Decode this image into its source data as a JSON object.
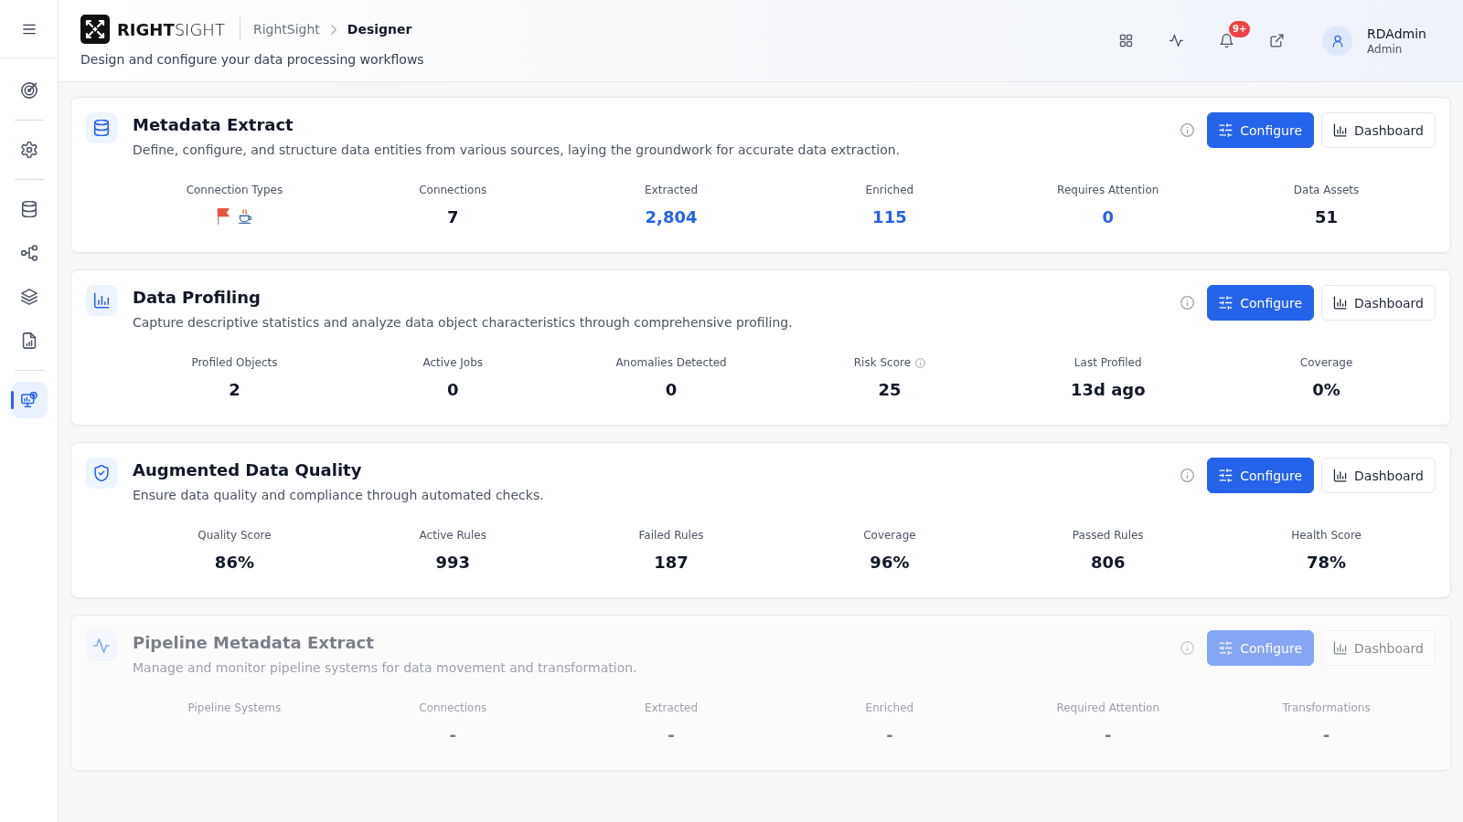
{
  "sidebar": {
    "groups": [
      [
        {
          "selected": false
        }
      ],
      [
        {
          "selected": false
        }
      ],
      [
        {
          "selected": false
        },
        {
          "selected": false
        },
        {
          "selected": false
        },
        {
          "selected": false
        }
      ],
      [
        {
          "selected": true
        }
      ]
    ]
  },
  "header": {
    "brand": "**RIGHT**SIGHT",
    "breadcrumb": [
      {
        "label": "RightSight",
        "current": false
      },
      {
        "label": "Designer",
        "current": true
      }
    ],
    "subtitle": "Design and configure your data processing workflows",
    "notification_badge": "9+",
    "user": {
      "name": "RDAdmin",
      "role": "Admin"
    }
  },
  "cards": [
    {
      "title": "Metadata Extract",
      "description": "Define, configure, and structure data entities from various sources, laying the groundwork for accurate data extraction.",
      "disabled": false,
      "buttons": [
        {
          "label": "Configure",
          "kind": "primary"
        },
        {
          "label": "Dashboard",
          "kind": "outline"
        }
      ],
      "stats": [
        {
          "label": "Connection Types",
          "kind": "icons",
          "info": false
        },
        {
          "label": "Connections",
          "kind": "value",
          "value": "7",
          "highlight": false,
          "info": false
        },
        {
          "label": "Extracted",
          "kind": "value",
          "value": "2,804",
          "highlight": true,
          "info": false
        },
        {
          "label": "Enriched",
          "kind": "value",
          "value": "115",
          "highlight": true,
          "info": false
        },
        {
          "label": "Requires Attention",
          "kind": "value",
          "value": "0",
          "highlight": true,
          "info": false
        },
        {
          "label": "Data Assets",
          "kind": "value",
          "value": "51",
          "highlight": false,
          "info": false
        }
      ]
    },
    {
      "title": "Data Profiling",
      "description": "Capture descriptive statistics and analyze data object characteristics through comprehensive profiling.",
      "disabled": false,
      "buttons": [
        {
          "label": "Configure",
          "kind": "primary"
        },
        {
          "label": "Dashboard",
          "kind": "outline"
        }
      ],
      "stats": [
        {
          "label": "Profiled Objects",
          "kind": "value",
          "value": "2",
          "highlight": false,
          "info": false
        },
        {
          "label": "Active Jobs",
          "kind": "value",
          "value": "0",
          "highlight": false,
          "info": false
        },
        {
          "label": "Anomalies Detected",
          "kind": "value",
          "value": "0",
          "highlight": false,
          "info": false
        },
        {
          "label": "Risk Score",
          "kind": "value",
          "value": "25",
          "highlight": false,
          "info": true
        },
        {
          "label": "Last Profiled",
          "kind": "value",
          "value": "13d ago",
          "highlight": false,
          "info": false
        },
        {
          "label": "Coverage",
          "kind": "value",
          "value": "0%",
          "highlight": false,
          "info": false
        }
      ]
    },
    {
      "title": "Augmented Data Quality",
      "description": "Ensure data quality and compliance through automated checks.",
      "disabled": false,
      "buttons": [
        {
          "label": "Configure",
          "kind": "primary"
        },
        {
          "label": "Dashboard",
          "kind": "outline"
        }
      ],
      "stats": [
        {
          "label": "Quality Score",
          "kind": "value",
          "value": "86%",
          "highlight": false,
          "info": false
        },
        {
          "label": "Active Rules",
          "kind": "value",
          "value": "993",
          "highlight": false,
          "info": false
        },
        {
          "label": "Failed Rules",
          "kind": "value",
          "value": "187",
          "highlight": false,
          "info": false
        },
        {
          "label": "Coverage",
          "kind": "value",
          "value": "96%",
          "highlight": false,
          "info": false
        },
        {
          "label": "Passed Rules",
          "kind": "value",
          "value": "806",
          "highlight": false,
          "info": false
        },
        {
          "label": "Health Score",
          "kind": "value",
          "value": "78%",
          "highlight": false,
          "info": false
        }
      ]
    },
    {
      "title": "Pipeline Metadata Extract",
      "description": "Manage and monitor pipeline systems for data movement and transformation.",
      "disabled": true,
      "buttons": [
        {
          "label": "Configure",
          "kind": "primary"
        },
        {
          "label": "Dashboard",
          "kind": "outline"
        }
      ],
      "stats": [
        {
          "label": "Pipeline Systems",
          "kind": "value",
          "info": false
        },
        {
          "label": "Connections",
          "kind": "value",
          "value": "-",
          "highlight": false,
          "info": false
        },
        {
          "label": "Extracted",
          "kind": "value",
          "value": "-",
          "highlight": false,
          "info": false
        },
        {
          "label": "Enriched",
          "kind": "value",
          "value": "-",
          "highlight": false,
          "info": false
        },
        {
          "label": "Required Attention",
          "kind": "value",
          "value": "-",
          "highlight": false,
          "info": false
        },
        {
          "label": "Transformations",
          "kind": "value",
          "value": "-",
          "highlight": false,
          "info": false
        }
      ]
    }
  ]
}
